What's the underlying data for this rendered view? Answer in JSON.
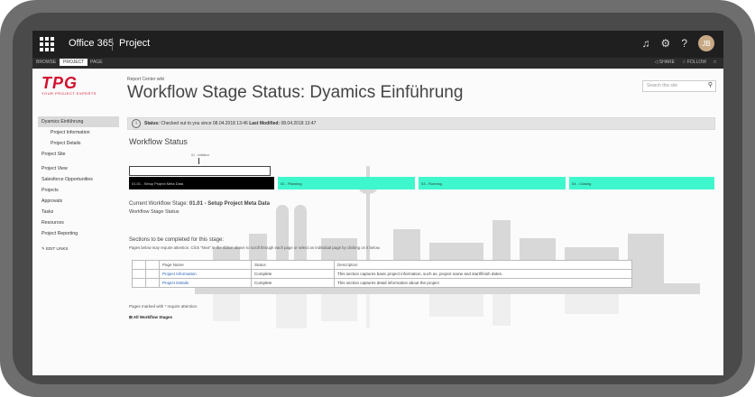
{
  "suite": {
    "waffle": "app-launcher-icon",
    "title": "Office 365",
    "app": "Project",
    "avatar": "JB"
  },
  "ribbon": {
    "tabs": [
      "BROWSE",
      "PROJECT",
      "PAGE"
    ],
    "share": "SHARE",
    "follow": "FOLLOW"
  },
  "logo": {
    "mark": "TPG",
    "tagline": "YOUR PROJECT EXPERTS"
  },
  "header": {
    "breadcrumb": "Report Center   wiki",
    "title": "Workflow Stage Status: Dyamics Einführung",
    "search_placeholder": "Search this site"
  },
  "nav": {
    "items": [
      {
        "label": "Dyamics Einführung",
        "selected": true
      },
      {
        "label": "Project Information",
        "sub": true
      },
      {
        "label": "Project Details",
        "sub": true
      },
      {
        "label": "Project Site"
      },
      {
        "label": "Project View"
      },
      {
        "label": "Salesforce Opportunities"
      },
      {
        "label": "Projects"
      },
      {
        "label": "Approvals"
      },
      {
        "label": "Tasks"
      },
      {
        "label": "Resources"
      },
      {
        "label": "Project Reporting"
      }
    ],
    "edit_links": "EDIT LINKS"
  },
  "status": {
    "label": "Status:",
    "text": "Checked out to you since 08.04.2018 13:46",
    "modified_label": "Last Modified:",
    "modified": "08.04.2018 13:47"
  },
  "workflow": {
    "title": "Workflow Status",
    "tick_label": "01 - Initiation",
    "stages": [
      {
        "label": "01.01 - Setup Project Meta Data",
        "color": "#000000"
      },
      {
        "label": "02 - Planning",
        "color": "#3ff7cd"
      },
      {
        "label": "03 - Running",
        "color": "#3ff7cd"
      },
      {
        "label": "04 - Closing",
        "color": "#3ff7cd"
      }
    ],
    "current_prefix": "Current Workflow Stage:",
    "current_value": "01.01 - Setup Project Meta Data",
    "stage_status": "Workflow Stage Status"
  },
  "sections": {
    "title": "Sections to be completed for this stage:",
    "hint": "Pages below may require attention. Click \"Next\" in the ribbon above to scroll through each page or select an individual page by clicking on it below.",
    "columns": [
      "Page Name",
      "Status",
      "Description"
    ],
    "rows": [
      {
        "name": "Project Information",
        "status": "Complete",
        "description": "This section captures basic project information, such as, project name and start/finish dates."
      },
      {
        "name": "Project Details",
        "status": "Complete",
        "description": "This section captures detail information about the project"
      }
    ],
    "note": "Pages marked with * require attention.",
    "all_stages": "All Workflow Stages"
  }
}
